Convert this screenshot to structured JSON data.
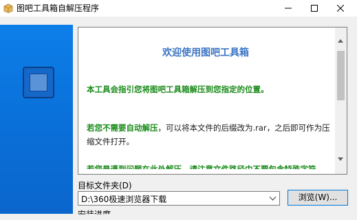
{
  "window": {
    "title": "图吧工具箱自解压程序",
    "app_icon": "package-icon",
    "controls": {
      "minimize": "minimize-icon",
      "maximize": "maximize-icon",
      "close": "close-icon"
    }
  },
  "content": {
    "title": "欢迎使用图吧工具箱",
    "para1_highlight": "本工具会指引您将图吧工具箱解压到您指定的位置。",
    "para2_highlight": "若您不需要自动解压",
    "para2_rest": "，可以将本文件的后缀改为.rar，之后即可作为压缩文件打开。",
    "para3_partial": "若您是遇到问题在此处解压，请注意文件路径中不要包含特殊字符。"
  },
  "folder": {
    "label": "目标文件夹(D)",
    "path": "D:\\360极速浏览器下载",
    "browse_label": "浏览(W)..."
  },
  "install": {
    "label": "安装进度"
  },
  "colors": {
    "sidebar": "#0a6fd8",
    "title": "#3a74c4",
    "highlight": "#1a8b1a",
    "focus": "#0078d7"
  }
}
